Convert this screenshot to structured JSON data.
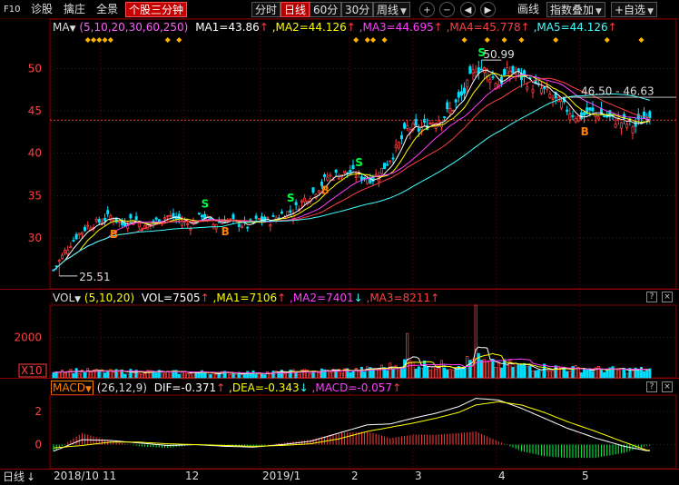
{
  "toolbar": {
    "f10": "F10",
    "items": [
      "诊股",
      "擒庄",
      "全景"
    ],
    "selected_tab": "个股三分钟",
    "periods": [
      "分时",
      "日线",
      "60分",
      "30分",
      "周线"
    ],
    "active_period": "日线",
    "draw": "画线",
    "overlay": "指数叠加",
    "watchlist": "+自选"
  },
  "main_legend": {
    "name": "MA",
    "params": "(5,10,20,30,60,250)",
    "ma1": "MA1=43.86",
    "ma2": ",MA2=44.126",
    "ma3": ",MA3=44.695",
    "ma4": ",MA4=45.778",
    "ma5": ",MA5=44.126"
  },
  "volume_legend": {
    "name": "VOL",
    "params": "(5,10,20)",
    "vol": "VOL=7505",
    "ma1": ",MA1=7106",
    "ma2": ",MA2=7401",
    "ma3": ",MA3=8211"
  },
  "macd_legend": {
    "name": "MACD",
    "params": "(26,12,9)",
    "dif": "DIF=-0.371",
    "dea": ",DEA=-0.343",
    "macd": ",MACD=-0.057"
  },
  "annotations": {
    "high": "50.99",
    "low": "25.51",
    "range": "46.50 - 46.63",
    "volume_unit": "X10",
    "period_switch": "日线"
  },
  "colors": {
    "up": "#ff3c3c",
    "down": "#00e0ff",
    "ma1": "#ffffff",
    "ma2": "#ffff00",
    "ma3": "#ff40ff",
    "ma4": "#ff4040",
    "ma5": "#40ffff",
    "grid": "#7a0000",
    "signal_s": "#00ff40",
    "signal_b": "#ff8000",
    "diamond": "#ffb400"
  },
  "chart_data": [
    {
      "type": "candlestick",
      "series": [
        {
          "name": "MA1",
          "values": [
            43.86
          ]
        },
        {
          "name": "MA2",
          "values": [
            44.126
          ]
        },
        {
          "name": "MA3",
          "values": [
            44.695
          ]
        },
        {
          "name": "MA4",
          "values": [
            45.778
          ]
        },
        {
          "name": "MA5",
          "values": [
            44.126
          ]
        }
      ],
      "y_ticks": [
        30,
        35,
        40,
        45,
        50
      ],
      "ylim": [
        24,
        54
      ],
      "x_ticks": [
        "2018/10",
        "11",
        "12",
        "2019/1",
        "2",
        "3",
        "4",
        "5"
      ],
      "high": 50.99,
      "low": 25.51,
      "close_profile": [
        [
          0,
          26.2
        ],
        [
          4,
          28.4
        ],
        [
          8,
          30.2
        ],
        [
          12,
          31.4
        ],
        [
          16,
          31.9
        ],
        [
          20,
          32.6
        ],
        [
          24,
          31.6
        ],
        [
          28,
          32.4
        ],
        [
          32,
          31.2
        ],
        [
          36,
          32.0
        ],
        [
          40,
          32.6
        ],
        [
          44,
          32.2
        ],
        [
          48,
          31.5
        ],
        [
          52,
          32.8
        ],
        [
          56,
          31.6
        ],
        [
          60,
          32.2
        ],
        [
          64,
          31.8
        ],
        [
          68,
          31.4
        ],
        [
          72,
          32.2
        ],
        [
          76,
          32.0
        ],
        [
          80,
          32.8
        ],
        [
          84,
          33.2
        ],
        [
          88,
          34.6
        ],
        [
          92,
          35.6
        ],
        [
          96,
          37.2
        ],
        [
          100,
          37.5
        ],
        [
          104,
          37.8
        ],
        [
          108,
          37.2
        ],
        [
          112,
          37.0
        ],
        [
          116,
          38.4
        ],
        [
          120,
          40.4
        ],
        [
          124,
          43.0
        ],
        [
          128,
          42.8
        ],
        [
          132,
          43.6
        ],
        [
          136,
          44.2
        ],
        [
          140,
          45.4
        ],
        [
          144,
          47.2
        ],
        [
          148,
          50.2
        ],
        [
          152,
          49.6
        ],
        [
          156,
          48.2
        ],
        [
          160,
          49.8
        ],
        [
          164,
          49.0
        ],
        [
          168,
          48.0
        ],
        [
          172,
          47.4
        ],
        [
          176,
          46.2
        ],
        [
          180,
          45.2
        ],
        [
          184,
          44.2
        ],
        [
          188,
          44.8
        ],
        [
          192,
          44.6
        ],
        [
          196,
          44.0
        ],
        [
          200,
          43.6
        ],
        [
          204,
          43.2
        ],
        [
          208,
          44.6
        ]
      ]
    },
    {
      "type": "bar",
      "series": [
        {
          "name": "VOL",
          "values": [
            7505
          ]
        },
        {
          "name": "MA1",
          "values": [
            7106
          ]
        },
        {
          "name": "MA2",
          "values": [
            7401
          ]
        },
        {
          "name": "MA3",
          "values": [
            8211
          ]
        }
      ],
      "y_ticks": [
        2000
      ],
      "volume_profile": [
        [
          0,
          380
        ],
        [
          10,
          320
        ],
        [
          20,
          280
        ],
        [
          30,
          300
        ],
        [
          40,
          250
        ],
        [
          50,
          260
        ],
        [
          60,
          230
        ],
        [
          70,
          240
        ],
        [
          80,
          260
        ],
        [
          90,
          300
        ],
        [
          100,
          340
        ],
        [
          110,
          380
        ],
        [
          118,
          520
        ],
        [
          124,
          700
        ],
        [
          130,
          620
        ],
        [
          140,
          560
        ],
        [
          148,
          900
        ],
        [
          152,
          640
        ],
        [
          160,
          600
        ],
        [
          170,
          500
        ],
        [
          180,
          440
        ],
        [
          190,
          400
        ],
        [
          200,
          360
        ],
        [
          208,
          380
        ]
      ]
    },
    {
      "type": "line",
      "series": [
        {
          "name": "DIF",
          "values": [
            -0.371
          ]
        },
        {
          "name": "DEA",
          "values": [
            -0.343
          ]
        },
        {
          "name": "MACD",
          "values": [
            -0.057
          ]
        }
      ],
      "y_ticks": [
        0,
        2
      ],
      "ylim": [
        -1.4,
        3.0
      ],
      "dif_profile": [
        [
          0,
          -0.4
        ],
        [
          10,
          0.3
        ],
        [
          20,
          0.25
        ],
        [
          30,
          0.1
        ],
        [
          40,
          -0.05
        ],
        [
          50,
          0.0
        ],
        [
          60,
          -0.1
        ],
        [
          70,
          -0.15
        ],
        [
          80,
          0.0
        ],
        [
          90,
          0.2
        ],
        [
          100,
          0.7
        ],
        [
          110,
          1.2
        ],
        [
          118,
          1.25
        ],
        [
          126,
          1.6
        ],
        [
          134,
          1.9
        ],
        [
          142,
          2.3
        ],
        [
          148,
          2.8
        ],
        [
          156,
          2.7
        ],
        [
          164,
          2.2
        ],
        [
          172,
          1.6
        ],
        [
          180,
          1.0
        ],
        [
          190,
          0.4
        ],
        [
          200,
          -0.1
        ],
        [
          208,
          -0.37
        ]
      ],
      "dea_profile": [
        [
          0,
          -0.2
        ],
        [
          10,
          -0.05
        ],
        [
          20,
          0.15
        ],
        [
          30,
          0.15
        ],
        [
          40,
          0.05
        ],
        [
          50,
          0.0
        ],
        [
          60,
          -0.05
        ],
        [
          70,
          -0.1
        ],
        [
          80,
          -0.05
        ],
        [
          90,
          0.05
        ],
        [
          100,
          0.35
        ],
        [
          110,
          0.8
        ],
        [
          118,
          1.05
        ],
        [
          126,
          1.3
        ],
        [
          134,
          1.6
        ],
        [
          142,
          1.95
        ],
        [
          148,
          2.4
        ],
        [
          156,
          2.6
        ],
        [
          164,
          2.4
        ],
        [
          172,
          1.95
        ],
        [
          180,
          1.4
        ],
        [
          190,
          0.8
        ],
        [
          200,
          0.15
        ],
        [
          208,
          -0.34
        ]
      ]
    }
  ]
}
